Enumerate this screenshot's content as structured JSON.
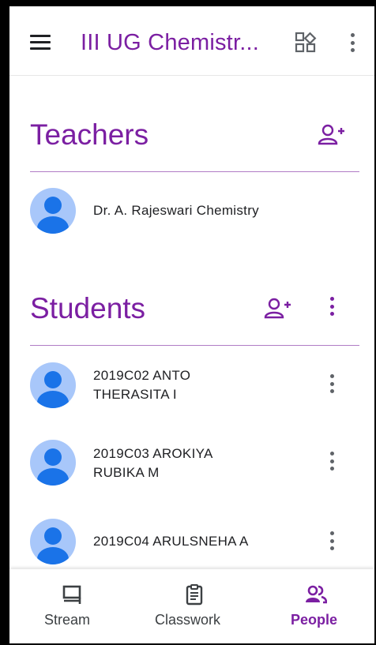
{
  "appbar": {
    "title": "III UG Chemistr...",
    "menu_icon": "hamburger-menu-icon",
    "apps_icon": "apps-grid-icon",
    "more_icon": "more-vert-icon"
  },
  "teachers": {
    "title": "Teachers",
    "add_icon": "add-person-icon",
    "items": [
      {
        "name": "Dr. A. Rajeswari Chemistry"
      }
    ]
  },
  "students": {
    "title": "Students",
    "add_icon": "add-person-icon",
    "more_icon": "more-vert-icon",
    "items": [
      {
        "line1": "2019C02 ANTO",
        "line2": "THERASITA I"
      },
      {
        "line1": "2019C03 AROKIYA",
        "line2": "RUBIKA M"
      },
      {
        "line1": "2019C04 ARULSNEHA A",
        "line2": ""
      }
    ]
  },
  "bottom_nav": {
    "items": [
      {
        "label": "Stream",
        "icon": "stream-icon",
        "active": false
      },
      {
        "label": "Classwork",
        "icon": "classwork-icon",
        "active": false
      },
      {
        "label": "People",
        "icon": "people-icon",
        "active": true
      }
    ]
  },
  "colors": {
    "accent": "#7b1fa2",
    "avatar_bg": "#a8c7fa",
    "avatar_fg": "#1a73e8"
  }
}
